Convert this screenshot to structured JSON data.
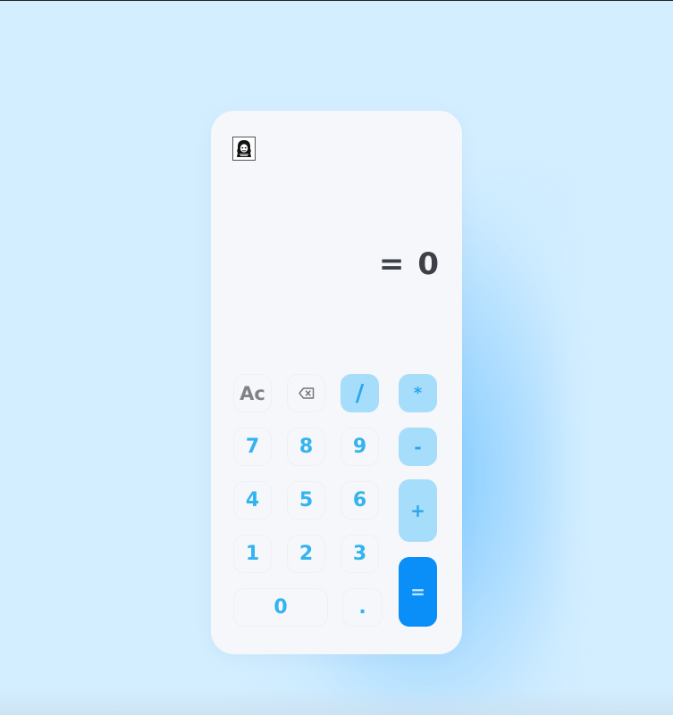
{
  "display": {
    "equals_sign": "=",
    "result": "0"
  },
  "keys": {
    "clear": "Ac",
    "backspace_icon": "backspace-icon",
    "divide": "/",
    "multiply": "*",
    "minus": "-",
    "plus": "+",
    "equals": "=",
    "seven": "7",
    "eight": "8",
    "nine": "9",
    "four": "4",
    "five": "5",
    "six": "6",
    "one": "1",
    "two": "2",
    "three": "3",
    "zero": "0",
    "decimal": "."
  },
  "colors": {
    "background": "#d3eeff",
    "panel": "#f5f7fb",
    "digit_text": "#33b3ef",
    "operator_bg": "#a5ddfb",
    "equals_bg": "#0a8ef7",
    "display_text": "#3d4147"
  },
  "logo_icon": "avatar-logo-icon"
}
